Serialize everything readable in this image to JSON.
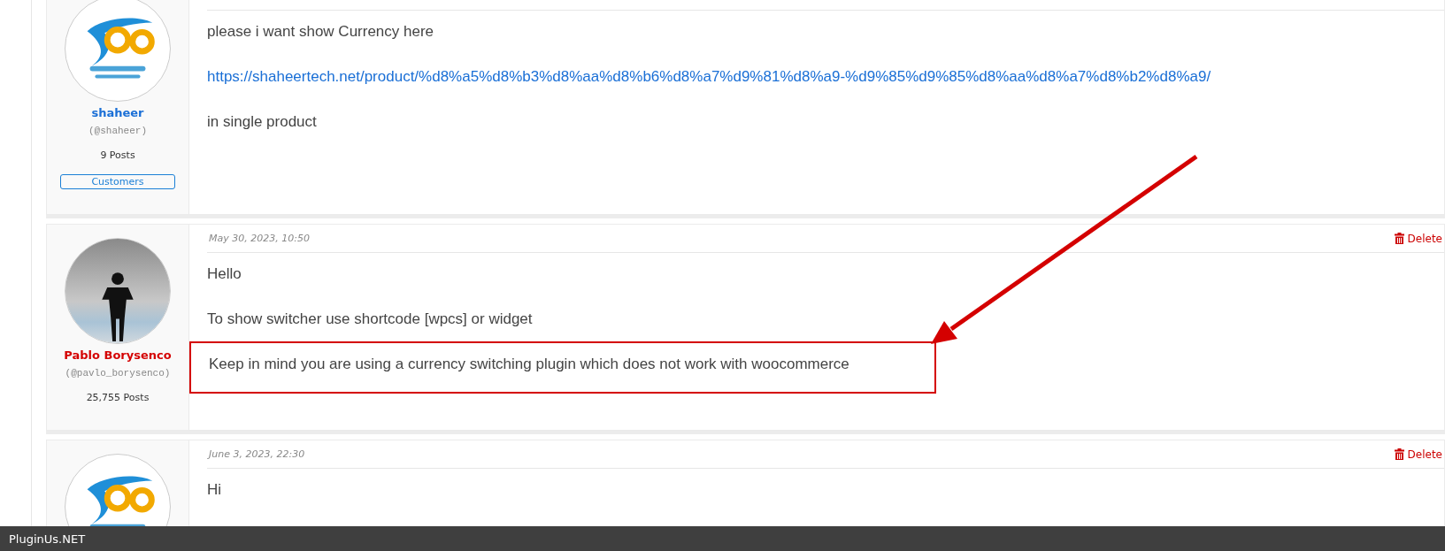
{
  "posts": [
    {
      "author": {
        "name": "shaheer",
        "color": "#1a6fd6",
        "handle": "(@shaheer)",
        "posts": "9 Posts",
        "badge": "Customers",
        "avatar": {
          "kind": "logo"
        }
      },
      "body": [
        {
          "kind": "text",
          "text": "please i want show Currency here",
          "highlighted": false
        },
        {
          "kind": "link",
          "text": "https://shaheertech.net/product/%d8%a5%d8%b3%d8%aa%d8%b6%d8%a7%d9%81%d8%a9-%d9%85%d9%85%d8%aa%d8%a7%d8%b2%d8%a9/",
          "highlighted": false
        },
        {
          "kind": "text",
          "text": "in single product",
          "highlighted": false
        }
      ]
    },
    {
      "author": {
        "name": "Pablo Borysenco",
        "color": "#d40000",
        "handle": "(@pavlo_borysenco)",
        "posts": "25,755 Posts",
        "avatar": {
          "kind": "photo"
        }
      },
      "date": "May 30, 2023, 10:50",
      "delete": "Delete",
      "body": [
        {
          "kind": "text",
          "text": "Hello",
          "highlighted": false
        },
        {
          "kind": "text",
          "text": "To show switcher use shortcode [wpcs] or widget",
          "highlighted": false
        },
        {
          "kind": "text",
          "text": "Keep in mind you are using a currency switching plugin which does not work with woocommerce",
          "highlighted": true
        }
      ]
    },
    {
      "author": {
        "avatar": {
          "kind": "logo"
        }
      },
      "date": "June 3, 2023, 22:30",
      "delete": "Delete",
      "body": [
        {
          "kind": "text",
          "text": "Hi",
          "highlighted": false
        }
      ]
    }
  ],
  "footer": {
    "brand": "PluginUs.NET"
  }
}
